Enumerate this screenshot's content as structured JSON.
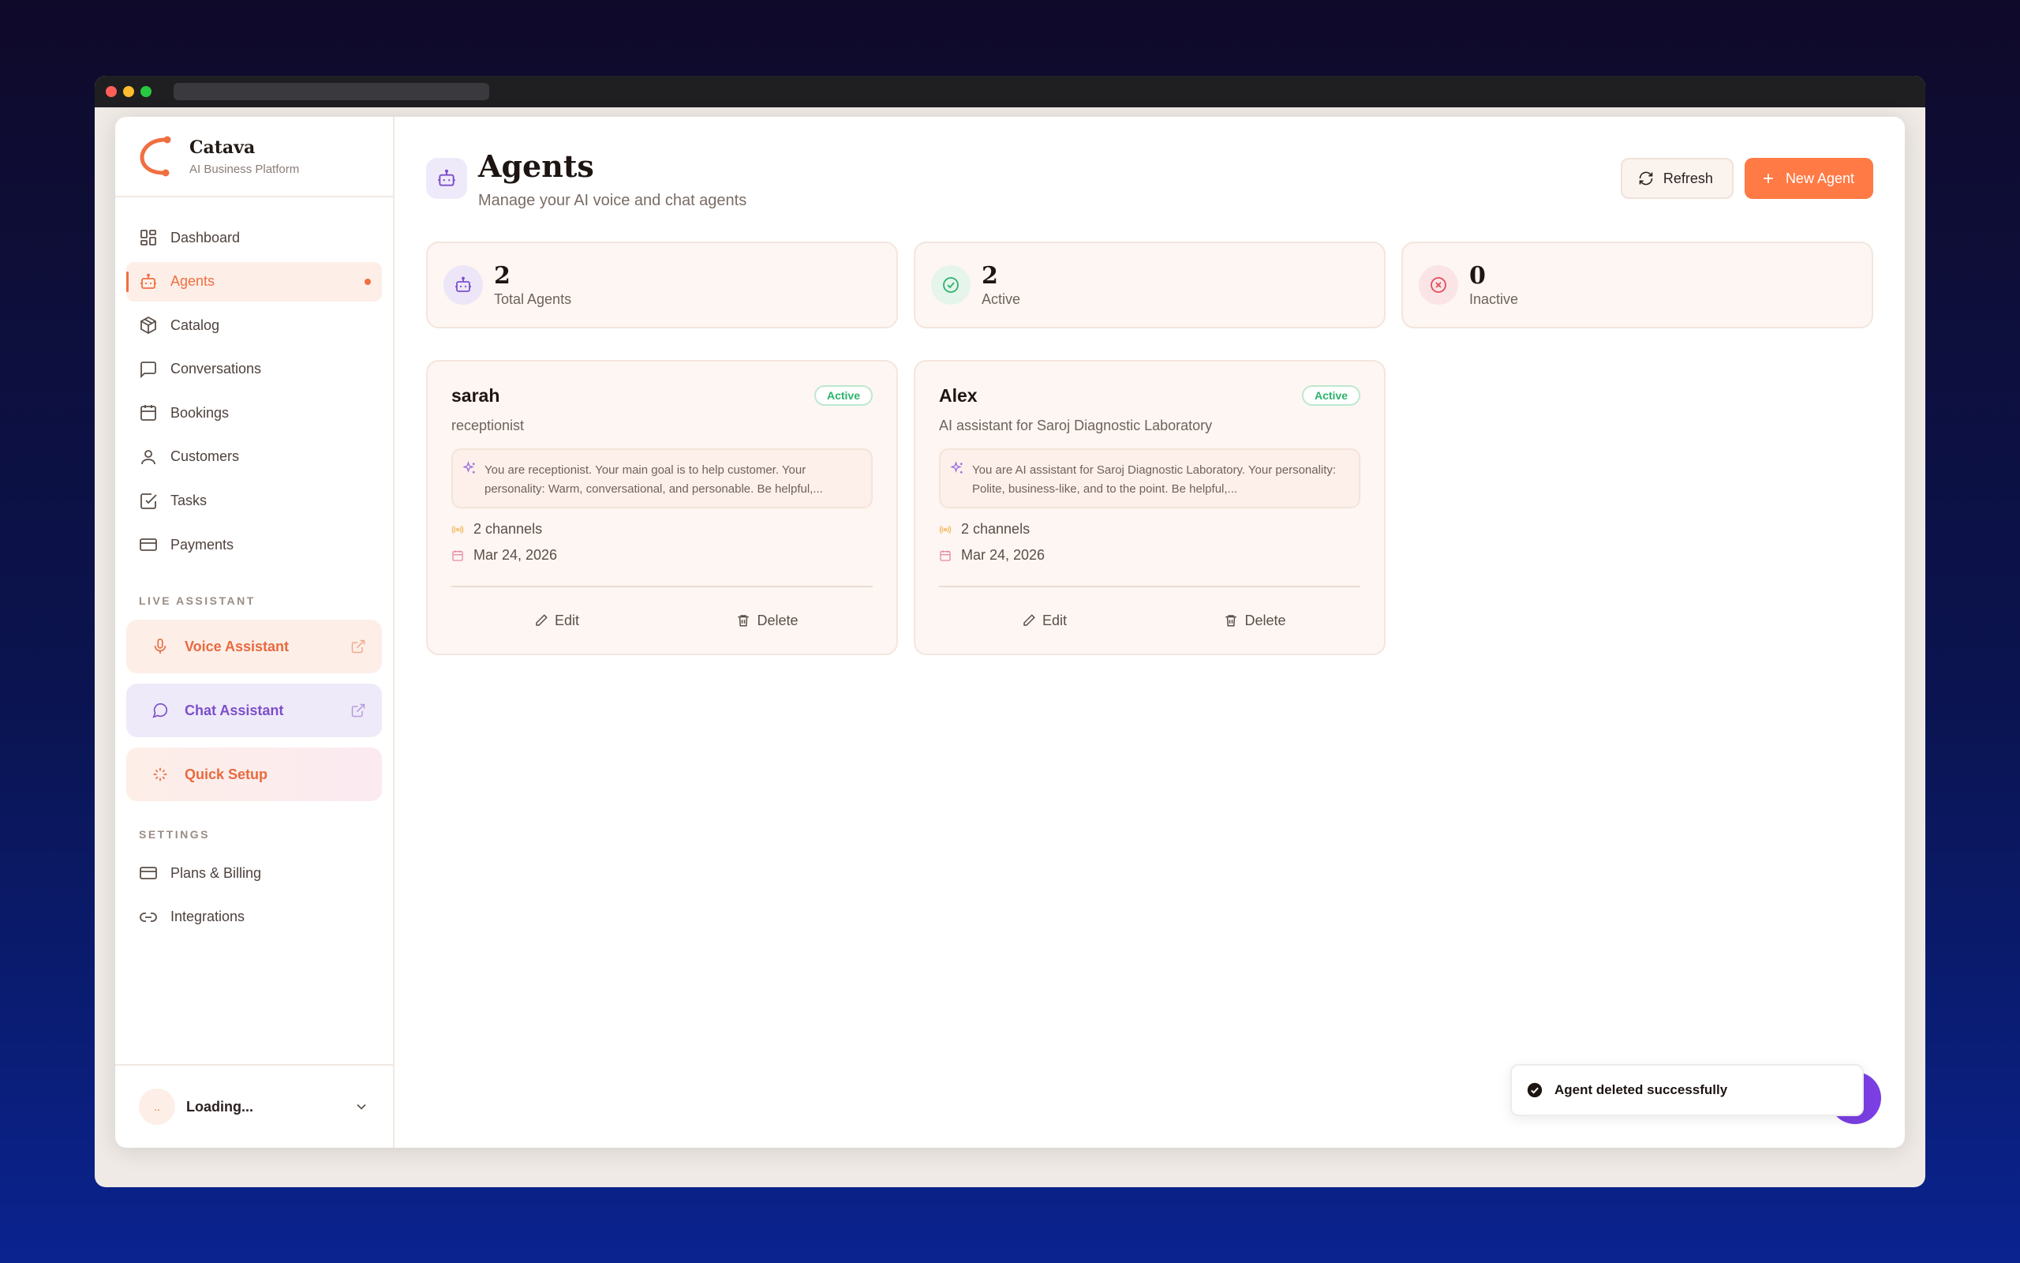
{
  "brand": {
    "name": "Catava",
    "subtitle": "AI Business Platform"
  },
  "sidebar": {
    "items": [
      {
        "label": "Dashboard",
        "icon": "dashboard-icon"
      },
      {
        "label": "Agents",
        "icon": "robot-icon",
        "active": true
      },
      {
        "label": "Catalog",
        "icon": "package-icon"
      },
      {
        "label": "Conversations",
        "icon": "message-icon"
      },
      {
        "label": "Bookings",
        "icon": "calendar-icon"
      },
      {
        "label": "Customers",
        "icon": "user-icon"
      },
      {
        "label": "Tasks",
        "icon": "checkbox-icon"
      },
      {
        "label": "Payments",
        "icon": "credit-card-icon"
      }
    ],
    "live_label": "LIVE ASSISTANT",
    "assistants": [
      {
        "label": "Voice Assistant",
        "icon": "mic-icon"
      },
      {
        "label": "Chat Assistant",
        "icon": "chat-icon"
      },
      {
        "label": "Quick Setup",
        "icon": "sparkle-icon"
      }
    ],
    "settings_label": "SETTINGS",
    "settings": [
      {
        "label": "Plans & Billing",
        "icon": "credit-card-icon"
      },
      {
        "label": "Integrations",
        "icon": "link-icon"
      }
    ],
    "user": {
      "avatar": "..",
      "name": "Loading..."
    }
  },
  "header": {
    "title": "Agents",
    "subtitle": "Manage your AI voice and chat agents",
    "refresh_label": "Refresh",
    "new_agent_label": "New Agent"
  },
  "stats": [
    {
      "value": "2",
      "label": "Total Agents",
      "color": "#7c4fc9"
    },
    {
      "value": "2",
      "label": "Active",
      "color": "#2bb36b"
    },
    {
      "value": "0",
      "label": "Inactive",
      "color": "#e24d5c"
    }
  ],
  "agents": [
    {
      "name": "sarah",
      "role": "receptionist",
      "status": "Active",
      "prompt": "You are receptionist. Your main goal is to help customer. Your personality: Warm, conversational, and personable. Be helpful,...",
      "channels": "2 channels",
      "date": "Mar 24, 2026",
      "edit_label": "Edit",
      "delete_label": "Delete"
    },
    {
      "name": "Alex",
      "role": "AI assistant for Saroj Diagnostic Laboratory",
      "status": "Active",
      "prompt": "You are AI assistant for Saroj Diagnostic Laboratory. Your personality: Polite, business-like, and to the point. Be helpful,...",
      "channels": "2 channels",
      "date": "Mar 24, 2026",
      "edit_label": "Edit",
      "delete_label": "Delete"
    }
  ],
  "toast": {
    "message": "Agent deleted successfully"
  },
  "colors": {
    "accent": "#ff7a45",
    "purple": "#7c4fc9",
    "green": "#2bb36b"
  }
}
